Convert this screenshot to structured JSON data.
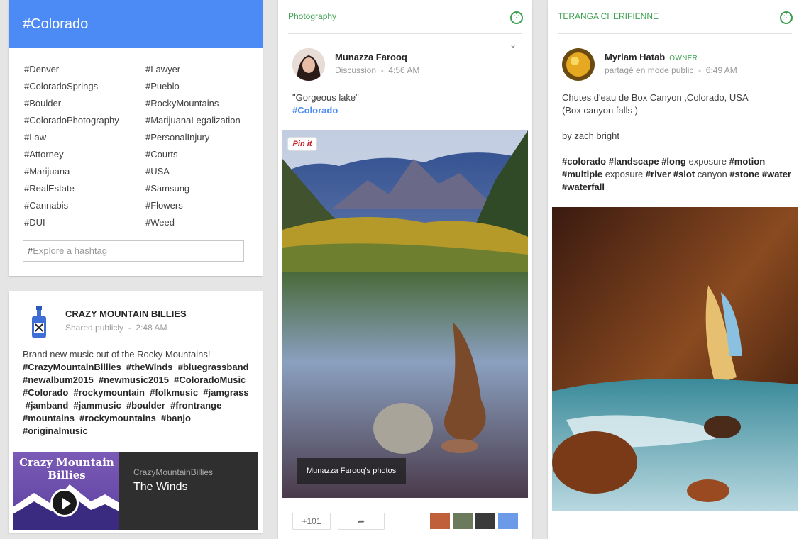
{
  "hashtag_card": {
    "title": "#Colorado",
    "tags_left": [
      "#Denver",
      "#ColoradoSprings",
      "#Boulder",
      "#ColoradoPhotography",
      "#Law",
      "#Attorney",
      "#Marijuana",
      "#RealEstate",
      "#Cannabis",
      "#DUI"
    ],
    "tags_right": [
      "#Lawyer",
      "#Pueblo",
      "#RockyMountains",
      "#MarijuanaLegalization",
      "#PersonalInjury",
      "#Courts",
      "#USA",
      "#Samsung",
      "#Flowers",
      "#Weed"
    ],
    "explore_pound": "#",
    "explore_placeholder": "Explore a hashtag"
  },
  "crazy_post": {
    "author": "CRAZY MOUNTAIN BILLIES",
    "meta_visibility": "Shared publicly",
    "meta_sep": "-",
    "meta_time": "2:48 AM",
    "intro": "Brand new music out of the Rocky Mountains!",
    "hashtag_lines": [
      "#CrazyMountainBillies  #theWinds  #bluegrassband",
      "#newalbum2015  #newmusic2015  #ColoradoMusic",
      "#Colorado  #rockymountain  #folkmusic  #jamgrass",
      " #jamband  #jammusic  #boulder  #frontrange",
      "#mountains  #rockymountains  #banjo",
      "#originalmusic"
    ],
    "embed": {
      "art_title": "Crazy Mountain Billies",
      "channel": "CrazyMountainBillies",
      "track": "The Winds"
    }
  },
  "photo_post": {
    "community": "Photography",
    "author": "Munazza Farooq",
    "meta_category": "Discussion",
    "meta_sep": "-",
    "meta_time": "4:56 AM",
    "text": "\"Gorgeous lake\"",
    "hashtag": "#Colorado",
    "pin_label": "Pin it",
    "photo_caption": "Munazza Farooq's photos",
    "plus_count": "+101",
    "share_label": "➦"
  },
  "teranga_post": {
    "community": "TERANGA CHERIFIENNE",
    "author": "Myriam Hatab",
    "badge": "OWNER",
    "meta_visibility": "partagé en mode public",
    "meta_sep": "-",
    "meta_time": "6:49 AM",
    "line1": "Chutes d'eau de Box Canyon ,Colorado, USA",
    "line2": "(Box canyon falls )",
    "line3": "by zach bright",
    "tag_line1": [
      {
        "t": "#colorado",
        "b": true
      },
      {
        "t": " ",
        "b": false
      },
      {
        "t": "#landscape",
        "b": true
      },
      {
        "t": " ",
        "b": false
      },
      {
        "t": "#long",
        "b": true
      },
      {
        "t": " exposure ",
        "b": false
      },
      {
        "t": "#motion",
        "b": true
      }
    ],
    "tag_line2": [
      {
        "t": "#multiple",
        "b": true
      },
      {
        "t": " exposure ",
        "b": false
      },
      {
        "t": "#river",
        "b": true
      },
      {
        "t": " ",
        "b": false
      },
      {
        "t": "#slot",
        "b": true
      },
      {
        "t": " canyon ",
        "b": false
      },
      {
        "t": "#stone",
        "b": true
      },
      {
        "t": " ",
        "b": false
      },
      {
        "t": "#water",
        "b": true
      }
    ],
    "tag_line3": [
      {
        "t": "#waterfall",
        "b": true
      }
    ]
  },
  "colors": {
    "accent_blue": "#4c8bf5",
    "community_green": "#3ca050",
    "background": "#e5e5e5"
  }
}
